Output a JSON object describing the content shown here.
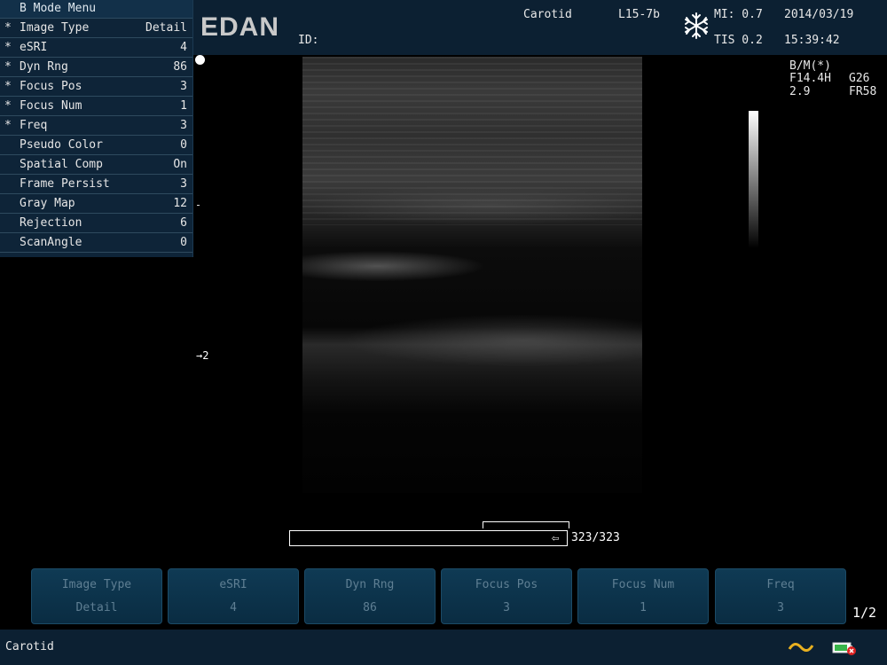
{
  "menu": {
    "title": "B Mode Menu",
    "items": [
      {
        "star": "*",
        "label": "Image Type",
        "value": "Detail"
      },
      {
        "star": "*",
        "label": "eSRI",
        "value": "4"
      },
      {
        "star": "*",
        "label": "Dyn Rng",
        "value": "86"
      },
      {
        "star": "*",
        "label": "Focus Pos",
        "value": "3"
      },
      {
        "star": "*",
        "label": "Focus Num",
        "value": "1"
      },
      {
        "star": "*",
        "label": "Freq",
        "value": "3"
      },
      {
        "star": "",
        "label": "Pseudo Color",
        "value": "0"
      },
      {
        "star": "",
        "label": "Spatial Comp",
        "value": "On"
      },
      {
        "star": "",
        "label": "Frame Persist",
        "value": "3"
      },
      {
        "star": "",
        "label": "Gray Map",
        "value": "12"
      },
      {
        "star": "",
        "label": "Rejection",
        "value": "6"
      },
      {
        "star": "",
        "label": "ScanAngle",
        "value": "0"
      }
    ]
  },
  "header": {
    "logo": "EDAN",
    "id_label": "ID:",
    "exam": "Carotid",
    "probe": "L15-7b",
    "freeze_icon": "snowflake-icon",
    "mi": "MI: 0.7",
    "tis": "TIS 0.2",
    "date": "2014/03/19",
    "time": "15:39:42"
  },
  "image_info": {
    "mode": "B/M(*)",
    "freq": "F14.4H",
    "gain": "G26",
    "depth": "2.9",
    "frame_rate": "FR58"
  },
  "focus_marker": "→2",
  "cine": {
    "counter": "323/323"
  },
  "soft_buttons": [
    {
      "title": "Image Type",
      "value": "Detail"
    },
    {
      "title": "eSRI",
      "value": "4"
    },
    {
      "title": "Dyn Rng",
      "value": "86"
    },
    {
      "title": "Focus Pos",
      "value": "3"
    },
    {
      "title": "Focus Num",
      "value": "1"
    },
    {
      "title": "Freq",
      "value": "3"
    }
  ],
  "page_indicator": "1/2",
  "footer": {
    "exam": "Carotid",
    "icons": [
      "wave-icon",
      "battery-icon"
    ]
  },
  "colors": {
    "panel": "#0c2032",
    "menu_bg": "#0e2438",
    "soft_button": "#0f3a54"
  }
}
